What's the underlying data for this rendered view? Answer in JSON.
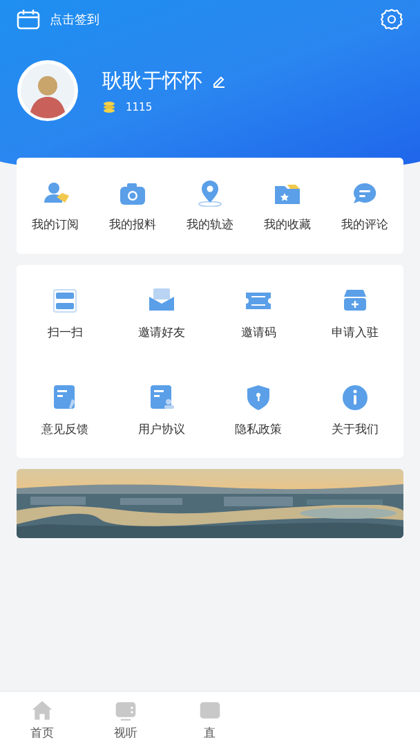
{
  "header": {
    "sign_in": "点击签到",
    "username": "耿耿于怀怀",
    "points": "1115"
  },
  "shortcuts": [
    {
      "label": "我的订阅"
    },
    {
      "label": "我的报料"
    },
    {
      "label": "我的轨迹"
    },
    {
      "label": "我的收藏"
    },
    {
      "label": "我的评论"
    }
  ],
  "services": [
    {
      "label": "扫一扫"
    },
    {
      "label": "邀请好友"
    },
    {
      "label": "邀请码"
    },
    {
      "label": "申请入驻"
    },
    {
      "label": "意见反馈"
    },
    {
      "label": "用户协议"
    },
    {
      "label": "隐私政策"
    },
    {
      "label": "关于我们"
    }
  ],
  "bottom_nav": [
    {
      "label": "首页",
      "selected": false
    },
    {
      "label": "视听",
      "selected": false
    },
    {
      "label": "直",
      "selected": false
    }
  ]
}
